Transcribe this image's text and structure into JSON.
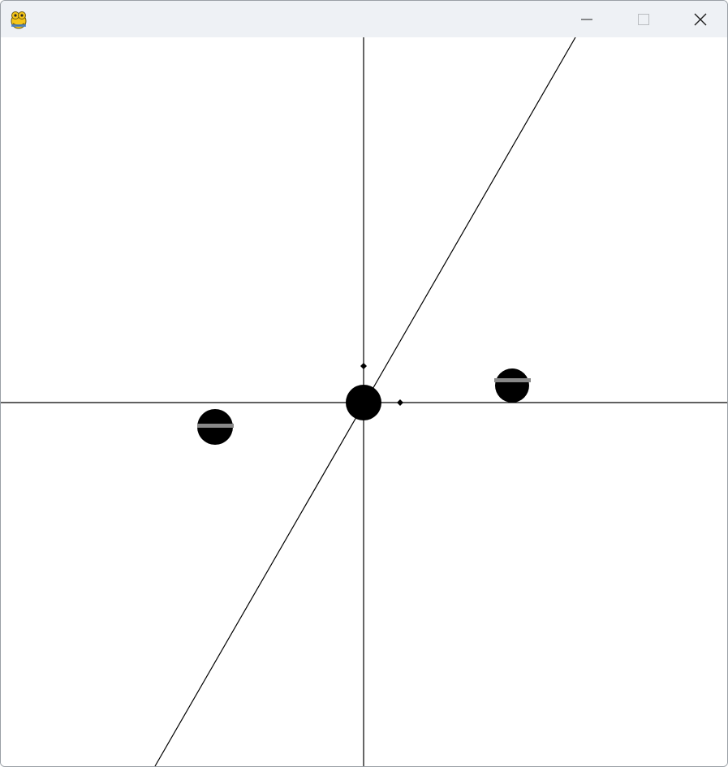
{
  "window": {
    "title": "",
    "app_icon": "pygame-snake-icon",
    "controls": {
      "minimize_icon": "minimize-icon",
      "maximize_icon": "maximize-icon",
      "close_icon": "close-icon"
    }
  },
  "scene": {
    "background_color": "#ffffff",
    "ink_color": "#000000",
    "marker_stripe_color": "#888888",
    "objects": [
      "horizontal-axis",
      "vertical-axis",
      "diagonal-line",
      "center-body",
      "left-body",
      "right-body",
      "x-marker",
      "y-marker"
    ]
  }
}
